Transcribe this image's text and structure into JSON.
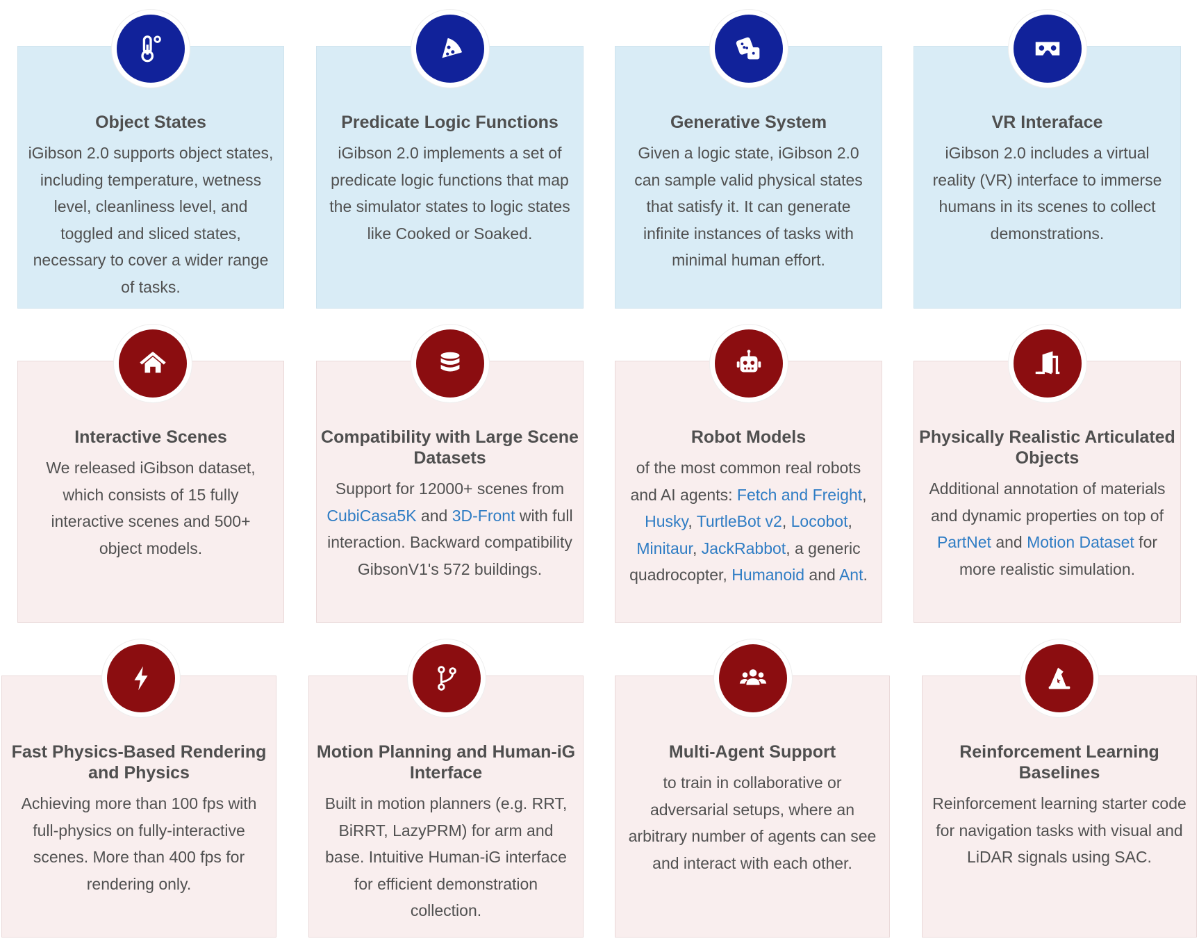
{
  "colors": {
    "blue_card": "#d9ecf6",
    "pink_card": "#f9eeee",
    "navy": "#11229a",
    "maroon": "#8b0d10",
    "link": "#2e7cc4"
  },
  "cards": [
    {
      "icon": "thermometer-icon",
      "title": "Object States",
      "desc": "iGibson 2.0 supports object states, including temperature, wetness level, cleanliness level, and toggled and sliced states, necessary to cover a wider range of tasks."
    },
    {
      "icon": "pizza-slice-icon",
      "title": "Predicate Logic Functions",
      "desc": "iGibson 2.0 implements a set of predicate logic functions that map the simulator states to logic states like Cooked or Soaked."
    },
    {
      "icon": "dice-icon",
      "title": "Generative System",
      "desc": "Given a logic state, iGibson 2.0 can sample valid physical states that satisfy it. It can generate infinite instances of tasks with minimal human effort."
    },
    {
      "icon": "vr-headset-icon",
      "title": "VR Interaface",
      "desc": "iGibson 2.0 includes a virtual reality (VR) interface to immerse humans in its scenes to collect demonstrations."
    },
    {
      "icon": "home-icon",
      "title": "Interactive Scenes",
      "desc": "We released iGibson dataset, which consists of 15 fully interactive scenes and 500+ object models."
    },
    {
      "icon": "database-icon",
      "title": "Compatibility with Large Scene Datasets",
      "desc_a": "Support for 12000+ scenes from ",
      "link_1": "CubiCasa5K",
      "desc_b": " and ",
      "link_2": "3D-Front",
      "desc_c": " with full interaction. Backward compatibility GibsonV1's 572 buildings."
    },
    {
      "icon": "robot-icon",
      "title": "Robot Models",
      "desc_a": "of the most common real robots and AI agents: ",
      "links": [
        "Fetch and Freight",
        "Husky",
        "TurtleBot v2",
        "Locobot",
        "Minitaur",
        "JackRabbot",
        "Humanoid",
        "Ant"
      ],
      "sep_comma": ", ",
      "desc_b": ", a generic quadrocopter, ",
      "desc_and": " and ",
      "desc_end": "."
    },
    {
      "icon": "door-open-icon",
      "title": "Physically Realistic Articulated Objects",
      "desc_a": "Additional annotation of materials and dynamic properties on top of ",
      "link_1": "PartNet",
      "desc_b": " and ",
      "link_2": "Motion Dataset",
      "desc_c": " for more realistic simulation."
    },
    {
      "icon": "bolt-icon",
      "title": "Fast Physics-Based Rendering and Physics",
      "desc": "Achieving more than 100 fps with full-physics on fully-interactive scenes. More than 400 fps for rendering only."
    },
    {
      "icon": "code-branch-icon",
      "title": "Motion Planning and Human-iG Interface",
      "desc": "Built in motion planners (e.g. RRT, BiRRT, LazyPRM) for arm and base. Intuitive Human-iG interface for efficient demonstration collection."
    },
    {
      "icon": "users-icon",
      "title": "Multi-Agent Support",
      "desc": "to train in collaborative or adversarial setups, where an arbitrary number of agents can see and interact with each other."
    },
    {
      "icon": "wizard-hat-icon",
      "title": "Reinforcement Learning Baselines",
      "desc": "Reinforcement learning starter code for navigation tasks with visual and LiDAR signals using SAC."
    }
  ]
}
